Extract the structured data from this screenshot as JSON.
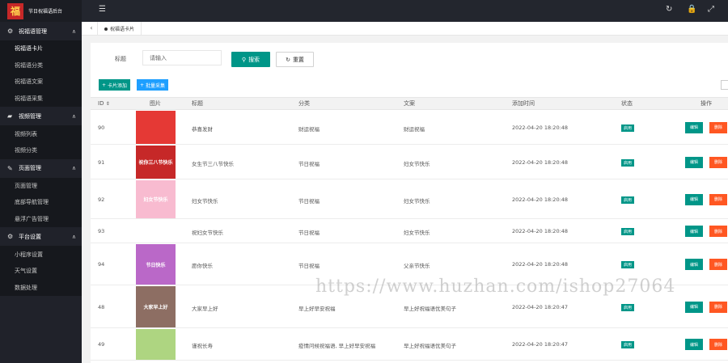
{
  "app": {
    "logo_char": "福",
    "title": "节日祝福语后台"
  },
  "sidebar": {
    "groups": [
      {
        "label": "祝福语管理",
        "icon": "gear-icon",
        "items": [
          "祝福语卡片",
          "祝福语分类",
          "祝福语文案",
          "祝福语采集"
        ]
      },
      {
        "label": "视频管理",
        "icon": "video-icon",
        "items": [
          "视频列表",
          "视频分类"
        ]
      },
      {
        "label": "页面管理",
        "icon": "wrench-icon",
        "items": [
          "页面管理",
          "底部导航管理",
          "悬浮广告管理"
        ]
      },
      {
        "label": "平台设置",
        "icon": "gear-icon",
        "items": [
          "小程序设置",
          "天气设置",
          "数据处理"
        ]
      }
    ]
  },
  "tabs": {
    "current": "祝福语卡片"
  },
  "search": {
    "label": "标题",
    "placeholder": "请输入",
    "search_btn": "搜索",
    "reset_btn": "重置"
  },
  "toolbar": {
    "add_btn": "卡片添加",
    "batch_btn": "批量采集"
  },
  "table": {
    "headers": {
      "id": "ID",
      "image": "图片",
      "title": "标题",
      "category": "分类",
      "text": "文案",
      "time": "添加时间",
      "status": "状态",
      "ops": "操作"
    },
    "rows": [
      {
        "id": "90",
        "title": "恭喜发财",
        "category": "财运祝福",
        "text": "财运祝福",
        "time": "2022-04-20 18:20:48",
        "status": "启用",
        "edit": "编辑",
        "del": "删除",
        "img_text": "",
        "img_color": "#e53935"
      },
      {
        "id": "91",
        "title": "女生节三八节快乐",
        "category": "节日祝福",
        "text": "妇女节快乐",
        "time": "2022-04-20 18:20:48",
        "status": "启用",
        "edit": "编辑",
        "del": "删除",
        "img_text": "祝你三八节快乐",
        "img_color": "#c62828"
      },
      {
        "id": "92",
        "title": "妇女节快乐",
        "category": "节日祝福",
        "text": "妇女节快乐",
        "time": "2022-04-20 18:20:48",
        "status": "启用",
        "edit": "编辑",
        "del": "删除",
        "img_text": "妇女节快乐",
        "img_color": "#f8bbd0"
      },
      {
        "id": "93",
        "title": "祝妇女节快乐",
        "category": "节日祝福",
        "text": "妇女节快乐",
        "time": "2022-04-20 18:20:48",
        "status": "启用",
        "edit": "编辑",
        "del": "删除",
        "img_text": "",
        "img_color": ""
      },
      {
        "id": "94",
        "title": "愿你快乐",
        "category": "节日祝福",
        "text": "父亲节快乐",
        "time": "2022-04-20 18:20:48",
        "status": "启用",
        "edit": "编辑",
        "del": "删除",
        "img_text": "节日快乐",
        "img_color": "#ba68c8"
      },
      {
        "id": "48",
        "title": "大家早上好",
        "category": "早上好早安祝福",
        "text": "早上好祝福语优美句子",
        "time": "2022-04-20 18:20:47",
        "status": "启用",
        "edit": "编辑",
        "del": "删除",
        "img_text": "大家早上好",
        "img_color": "#8d6e63"
      },
      {
        "id": "49",
        "title": "谨祝长寿",
        "category": "疫情问候祝福语, 早上好早安祝福",
        "text": "早上好祝福语优美句子",
        "time": "2022-04-20 18:20:47",
        "status": "启用",
        "edit": "编辑",
        "del": "删除",
        "img_text": "",
        "img_color": "#aed581"
      }
    ]
  },
  "watermark": "https://www.huzhan.com/ishop27064"
}
